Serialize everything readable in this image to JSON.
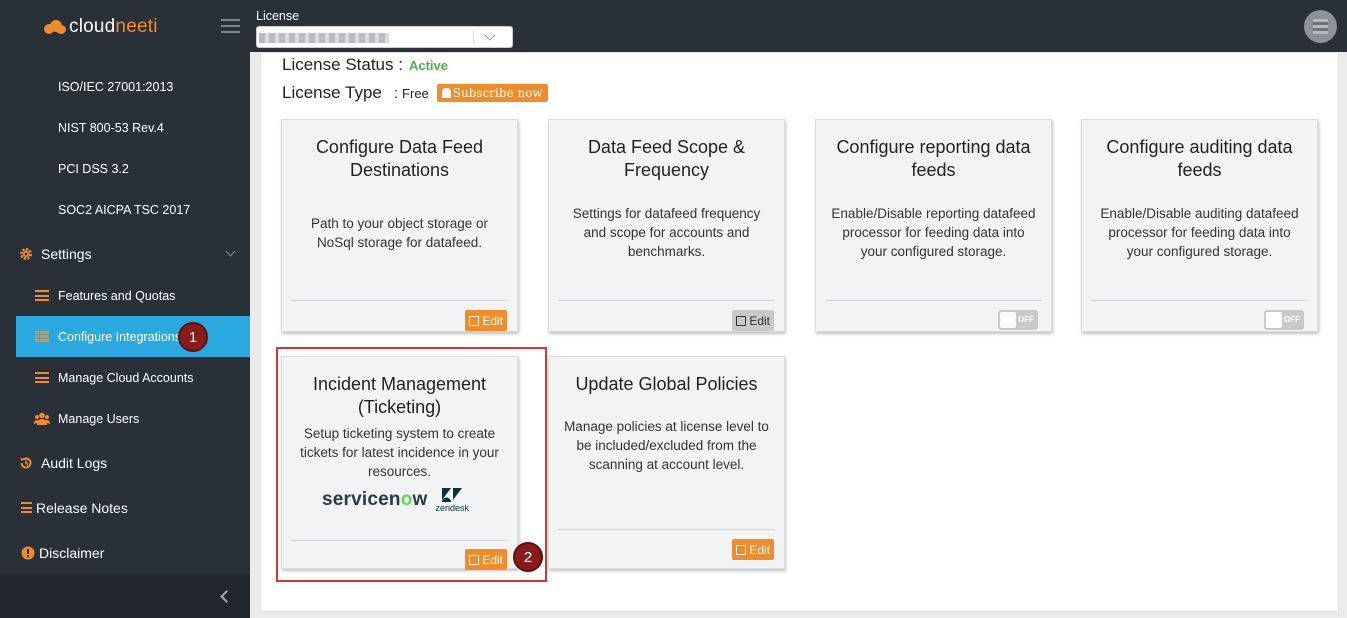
{
  "brand": {
    "part1": "cloud",
    "part2": "neeti"
  },
  "topbar": {
    "license_label": "License"
  },
  "sidebar": {
    "compliance_items": [
      "ISO/IEC 27001:2013",
      "NIST 800-53 Rev.4",
      "PCI DSS 3.2",
      "SOC2 AICPA TSC 2017"
    ],
    "settings_label": "Settings",
    "settings_items": [
      {
        "label": "Features and Quotas",
        "icon": "list-icon"
      },
      {
        "label": "Configure Integrations",
        "icon": "grid-icon"
      },
      {
        "label": "Manage Cloud Accounts",
        "icon": "list-icon"
      },
      {
        "label": "Manage Users",
        "icon": "users-icon"
      }
    ],
    "audit_logs": "Audit Logs",
    "release_notes": "Release Notes",
    "disclaimer": "Disclaimer"
  },
  "markers": {
    "one": "1",
    "two": "2"
  },
  "license": {
    "status_label": "License Status :",
    "status_value": "Active",
    "type_label": "License Type",
    "type_sep": ":",
    "type_value": "Free",
    "subscribe_label": "Subscribe now"
  },
  "cards": [
    {
      "title": "Configure Data Feed Destinations",
      "desc": "Path to your object storage or NoSql storage for datafeed.",
      "action": "Edit"
    },
    {
      "title": "Data Feed Scope & Frequency",
      "desc": "Settings for datafeed frequency and scope for accounts and benchmarks.",
      "action": "Edit"
    },
    {
      "title": "Configure reporting data feeds",
      "desc": "Enable/Disable reporting datafeed processor for feeding data into your configured storage.",
      "action": "OFF"
    },
    {
      "title": "Configure auditing data feeds",
      "desc": "Enable/Disable auditing datafeed processor for feeding data into your configured storage.",
      "action": "OFF"
    },
    {
      "title": "Incident Management (Ticketing)",
      "desc": "Setup ticketing system to create tickets for latest incidence in your resources.",
      "action": "Edit",
      "logo_a": "servicenow",
      "logo_b": "zendesk"
    },
    {
      "title": "Update Global Policies",
      "desc": "Manage policies at license level to be included/excluded from the scanning at account level.",
      "action": "Edit"
    }
  ],
  "colors": {
    "sidebar_bg": "#2a3038",
    "accent": "#f28c28",
    "active_nav": "#29a9df",
    "active_status": "#4caf50",
    "highlight": "#d93434"
  }
}
